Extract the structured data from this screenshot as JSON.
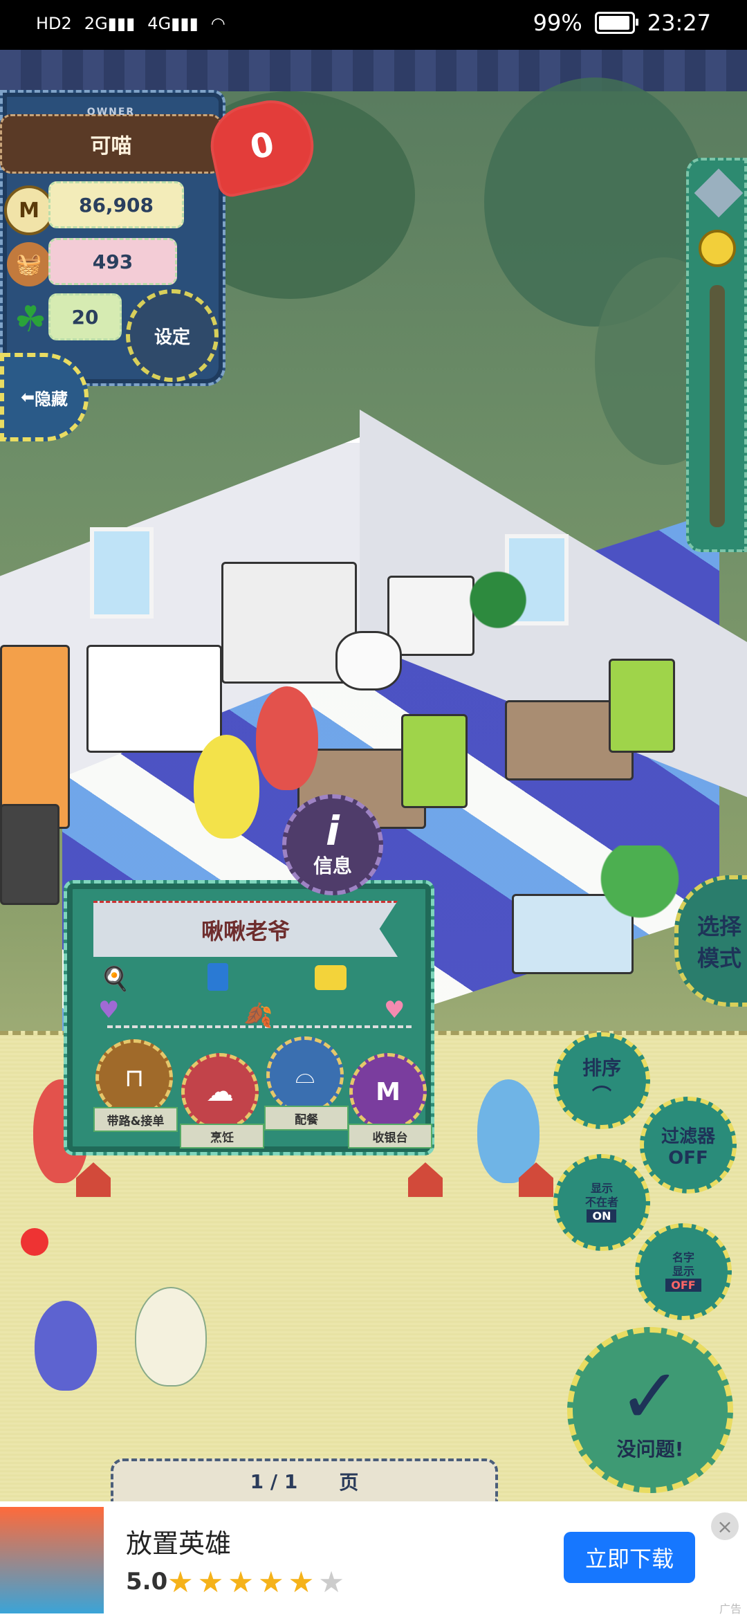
{
  "status_bar": {
    "hd": "HD2",
    "net1": "2G",
    "net2": "4G",
    "battery": "99%",
    "time": "23:27"
  },
  "owner": {
    "tag": "OWNER",
    "name": "可喵",
    "coins": "86,908",
    "food": "493",
    "clover": "20",
    "heart_count": "0",
    "coin_icon": "M"
  },
  "buttons": {
    "settings": "设定",
    "hide": "隐藏",
    "info": "信息",
    "select_mode": "选择模式",
    "sort": "排序",
    "filter_line1": "过滤器",
    "filter_line2": "OFF",
    "show_absent_line1": "显示",
    "show_absent_line2": "不在者",
    "show_absent_state": "ON",
    "show_name_line1": "名字",
    "show_name_line2": "显示",
    "show_name_state": "OFF",
    "ok": "没问题!"
  },
  "employee": {
    "name": "啾啾老爷",
    "skills": [
      {
        "label": "带路&接单",
        "icon": "table-icon",
        "color": "#a06a2a"
      },
      {
        "label": "烹饪",
        "icon": "chef-hat-icon",
        "color": "#c2434a"
      },
      {
        "label": "配餐",
        "icon": "serving-icon",
        "color": "#3a6fb0"
      },
      {
        "label": "收银台",
        "icon": "register-icon",
        "color": "#7a3d9e"
      }
    ]
  },
  "pager": {
    "current": "1 / 1",
    "unit": "页"
  },
  "ad": {
    "title": "放置英雄",
    "rating": "5.0",
    "stars_on": "★★★★★",
    "stars_off": "★",
    "cta": "立即下载",
    "close": "×",
    "tag": "广告"
  }
}
